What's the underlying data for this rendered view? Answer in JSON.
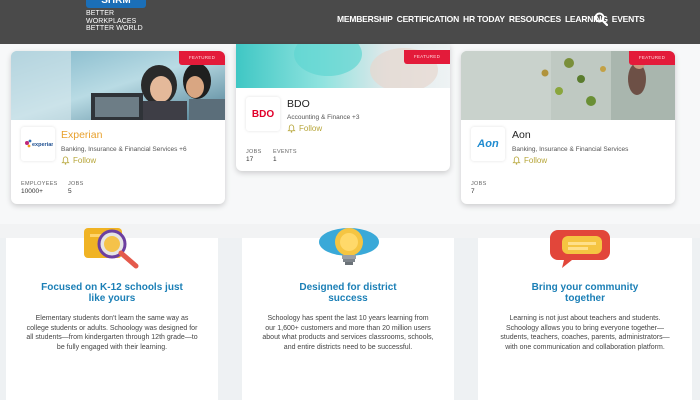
{
  "header": {
    "logo_text": "SHRM",
    "logo_tagline_1": "BETTER WORKPLACES",
    "logo_tagline_2": "BETTER WORLD",
    "nav": [
      "MEMBERSHIP",
      "CERTIFICATION",
      "HR TODAY",
      "RESOURCES",
      "LEARNING",
      "EVENTS"
    ],
    "search_icon": "search-icon",
    "colors": {
      "bar": "#4a4a4a",
      "brand": "#1b6fb8"
    }
  },
  "companies": [
    {
      "name": "Experian",
      "sector": "Banking, Insurance & Financial Services +6",
      "follow_label": "Follow",
      "tag": "FEATURED",
      "stats": [
        {
          "label": "EMPLOYEES",
          "value": "10000+"
        },
        {
          "label": "JOBS",
          "value": "5"
        }
      ],
      "name_color": "#e8a12e"
    },
    {
      "name": "BDO",
      "sector": "Accounting & Finance +3",
      "follow_label": "Follow",
      "tag": "FEATURED",
      "stats": [
        {
          "label": "JOBS",
          "value": "17"
        },
        {
          "label": "EVENTS",
          "value": "1"
        }
      ]
    },
    {
      "name": "Aon",
      "sector": "Banking, Insurance & Financial Services",
      "follow_label": "Follow",
      "tag": "FEATURED",
      "stats": [
        {
          "label": "JOBS",
          "value": "7"
        }
      ]
    }
  ],
  "features": [
    {
      "icon": "magnifier-icon",
      "title": "Focused on K-12 schools just like yours",
      "text": "Elementary students don't learn the same way as college students or adults. Schoology was designed for all students—from kindergarten through 12th grade—to be fully engaged with their learning."
    },
    {
      "icon": "lightbulb-icon",
      "title": "Designed for district success",
      "text": "Schoology has spent the last 10 years learning from our 1,600+ customers and more than 20 million users about what products and services classrooms, schools, and entire districts need to be successful."
    },
    {
      "icon": "speech-bubbles-icon",
      "title": "Bring your community together",
      "text": "Learning is not just about teachers and students. Schoology allows you to bring everyone together—students, teachers, coaches, parents, administrators—with one communication and collaboration platform."
    }
  ],
  "accent": {
    "feature_title": "#1b7fb6",
    "featured_tag": "#e31b3a",
    "follow": "#b7a63a"
  }
}
